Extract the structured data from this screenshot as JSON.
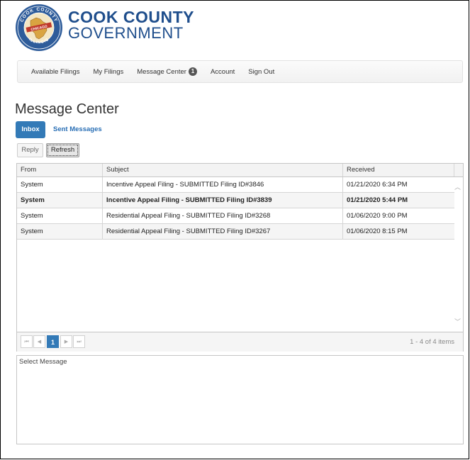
{
  "brand": {
    "line1": "COOK COUNTY",
    "line2": "GOVERNMENT",
    "seal_top_text": "COOK COUNTY",
    "seal_bottom_text": "ILLINOIS",
    "seal_left_text": "SEAL OF",
    "seal_ribbon": "CHICAGO",
    "colors": {
      "brand_blue": "#1f4e8c",
      "seal_blue": "#2e5c9a",
      "seal_gold": "#d9a441"
    }
  },
  "nav": {
    "items": [
      {
        "label": "Available Filings"
      },
      {
        "label": "My Filings"
      },
      {
        "label": "Message Center",
        "badge": "1"
      },
      {
        "label": "Account"
      },
      {
        "label": "Sign Out"
      }
    ]
  },
  "page": {
    "title": "Message Center"
  },
  "tabs": {
    "inbox": "Inbox",
    "sent": "Sent Messages"
  },
  "toolbar": {
    "reply": "Reply",
    "refresh": "Refresh"
  },
  "grid": {
    "columns": [
      "From",
      "Subject",
      "Received"
    ],
    "rows": [
      {
        "from": "System",
        "subject": "Incentive Appeal Filing - SUBMITTED Filing ID#3846",
        "received": "01/21/2020 6:34 PM",
        "bold": false
      },
      {
        "from": "System",
        "subject": "Incentive Appeal Filing - SUBMITTED Filing ID#3839",
        "received": "01/21/2020 5:44 PM",
        "bold": true
      },
      {
        "from": "System",
        "subject": "Residential Appeal Filing - SUBMITTED Filing ID#3268",
        "received": "01/06/2020 9:00 PM",
        "bold": false
      },
      {
        "from": "System",
        "subject": "Residential Appeal Filing - SUBMITTED Filing ID#3267",
        "received": "01/06/2020 8:15 PM",
        "bold": false
      }
    ],
    "pager": {
      "first": "⏮",
      "prev": "◀",
      "current": "1",
      "next": "▶",
      "last": "⏭",
      "info": "1 - 4 of 4 items"
    },
    "accent": "#337ab7"
  },
  "preview": {
    "placeholder": "Select Message"
  }
}
